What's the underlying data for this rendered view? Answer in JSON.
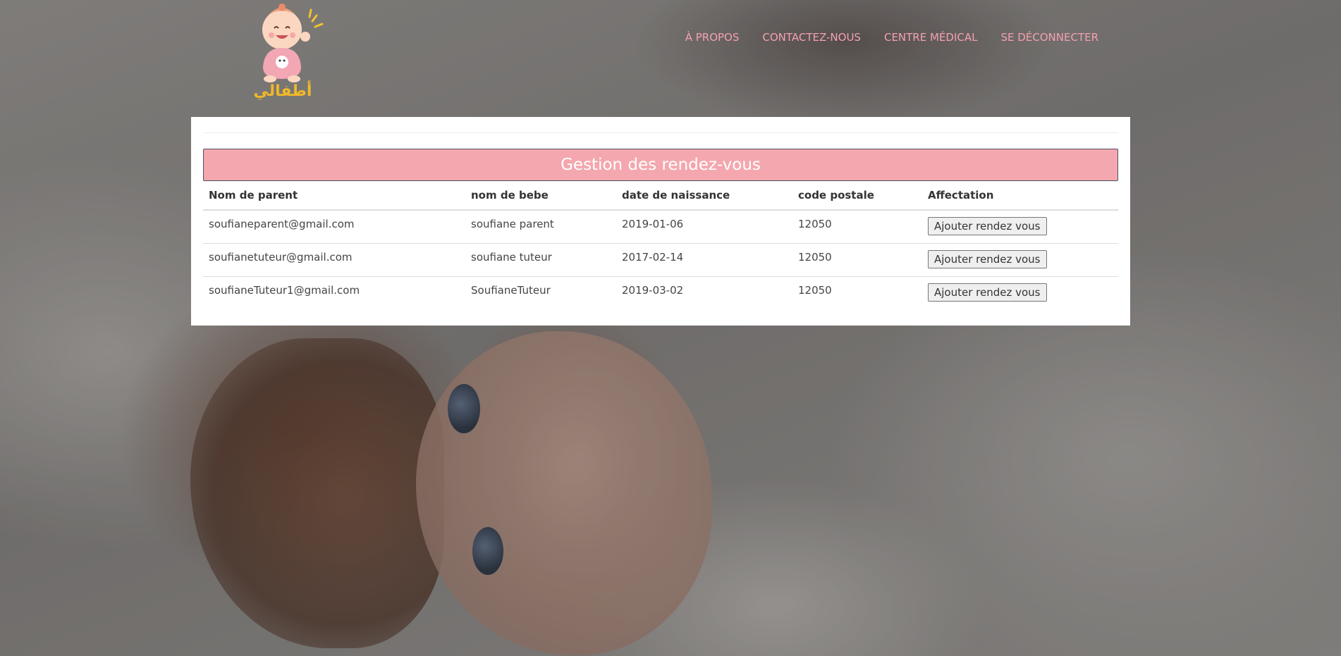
{
  "nav": {
    "items": [
      {
        "label": "À PROPOS"
      },
      {
        "label": "CONTACTEZ-NOUS"
      },
      {
        "label": "CENTRE MÉDICAL"
      },
      {
        "label": "SE DÉCONNECTER"
      }
    ]
  },
  "logo": {
    "text": "أطفالي"
  },
  "panel": {
    "title": "Gestion des rendez-vous"
  },
  "table": {
    "headers": [
      "Nom de parent",
      "nom de bebe",
      "date de naissance",
      "code postale",
      "Affectation"
    ],
    "rows": [
      {
        "parent": "soufianeparent@gmail.com",
        "bebe": "soufiane parent",
        "naissance": "2019-01-06",
        "postal": "12050",
        "action": "Ajouter rendez vous"
      },
      {
        "parent": "soufianetuteur@gmail.com",
        "bebe": "soufiane tuteur",
        "naissance": "2017-02-14",
        "postal": "12050",
        "action": "Ajouter rendez vous"
      },
      {
        "parent": "soufianeTuteur1@gmail.com",
        "bebe": "SoufianeTuteur",
        "naissance": "2019-03-02",
        "postal": "12050",
        "action": "Ajouter rendez vous"
      }
    ]
  },
  "colors": {
    "accent_pink": "#f4a7ae",
    "nav_pink": "#f4a1ae"
  }
}
